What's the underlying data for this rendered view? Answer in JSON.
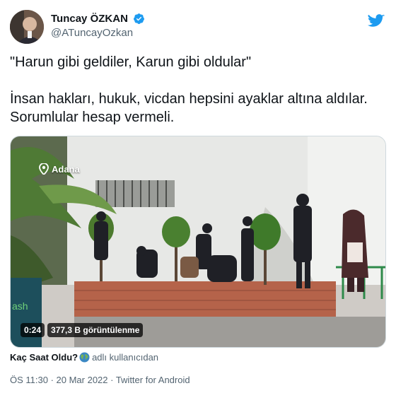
{
  "author": {
    "name": "Tuncay ÖZKAN",
    "handle": "@ATuncayOzkan",
    "verified": true
  },
  "tweet": {
    "line1": "\"Harun gibi geldiler, Karun gibi oldular\"",
    "line2": "İnsan hakları, hukuk, vicdan hepsini ayaklar altına aldılar. Sorumlular hesap vermeli."
  },
  "media": {
    "location": "Adana",
    "duration": "0:24",
    "views": "377,3 B görüntülenme",
    "sign_fragment": "ash"
  },
  "quoted_account": {
    "name": "Kaç Saat Oldu?",
    "handle": "adlı kullanıcıdan"
  },
  "meta": {
    "timestamp": "ÖS 11:30 · 20 Mar 2022 · Twitter for Android"
  },
  "colors": {
    "verified_blue": "#1d9bf0",
    "twitter_blue": "#1d9bf0",
    "text": "#0f1419",
    "secondary": "#536471"
  }
}
